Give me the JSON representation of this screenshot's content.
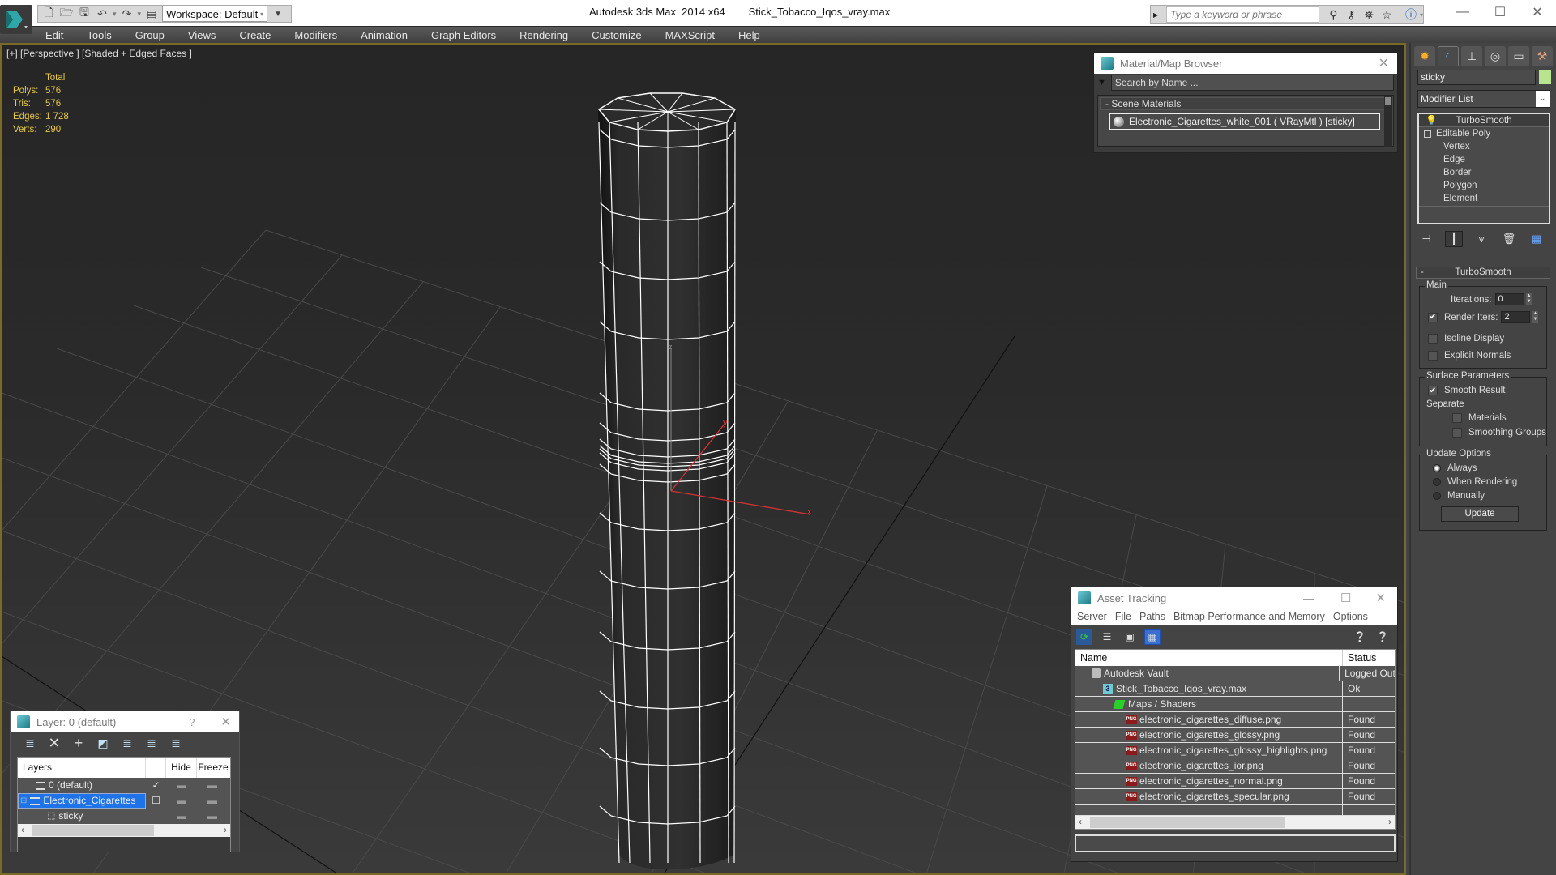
{
  "titlebar": {
    "app_title": "Autodesk 3ds Max  2014 x64",
    "file_name": "Stick_Tobacco_Iqos_vray.max",
    "workspace": "Workspace: Default",
    "search_placeholder": "Type a keyword or phrase",
    "quick_access": [
      "new-file-icon",
      "open-file-icon",
      "save-icon",
      "undo-icon",
      "redo-icon",
      "project-folder-icon"
    ],
    "info_icons": [
      "binoculars-icon",
      "key-icon",
      "satellite-icon",
      "star-icon",
      "help-icon"
    ],
    "window_buttons": {
      "minimize": "—",
      "maximize": "☐",
      "close": "✕"
    }
  },
  "menu": [
    "Edit",
    "Tools",
    "Group",
    "Views",
    "Create",
    "Modifiers",
    "Animation",
    "Graph Editors",
    "Rendering",
    "Customize",
    "MAXScript",
    "Help"
  ],
  "viewport": {
    "label": "[+] [Perspective ] [Shaded + Edged Faces ]",
    "stats": {
      "header": "Total",
      "rows": [
        {
          "key": "Polys:",
          "value": "576"
        },
        {
          "key": "Tris:",
          "value": "576"
        },
        {
          "key": "Edges:",
          "value": "1 728"
        },
        {
          "key": "Verts:",
          "value": "290"
        }
      ]
    },
    "axis_labels": {
      "x": "x",
      "y": "y",
      "z": "z"
    }
  },
  "material_browser": {
    "title": "Material/Map Browser",
    "search_placeholder": "Search by Name ...",
    "section": "- Scene Materials",
    "items": [
      "Electronic_Cigarettes_white_001  ( VRayMtl ) [sticky]"
    ]
  },
  "command_panel": {
    "tabs": [
      "create-tab",
      "modify-tab",
      "hierarchy-tab",
      "motion-tab",
      "display-tab",
      "utilities-tab"
    ],
    "object_name": "sticky",
    "object_color": "#b9e48f",
    "modifier_list": "Modifier List",
    "stack": {
      "top": "TurboSmooth",
      "base": "Editable Poly",
      "sub": [
        "Vertex",
        "Edge",
        "Border",
        "Polygon",
        "Element"
      ]
    },
    "turbosmooth": {
      "title": "TurboSmooth",
      "main_label": "Main",
      "iterations_label": "Iterations:",
      "iterations": "0",
      "render_iters_label": "Render Iters:",
      "render_iters": "2",
      "render_iters_checked": true,
      "isoline_label": "Isoline Display",
      "isoline_checked": false,
      "explicit_normals_label": "Explicit Normals",
      "explicit_normals_checked": false,
      "surface_label": "Surface Parameters",
      "smooth_result_label": "Smooth Result",
      "smooth_result_checked": true,
      "separate_label": "Separate",
      "materials_label": "Materials",
      "smoothing_groups_label": "Smoothing Groups",
      "update_label": "Update Options",
      "update_options": [
        "Always",
        "When Rendering",
        "Manually"
      ],
      "update_selected": "Always",
      "update_button": "Update"
    }
  },
  "asset_tracking": {
    "title": "Asset Tracking",
    "menu": [
      "Server",
      "File",
      "Paths",
      "Bitmap Performance and Memory",
      "Options"
    ],
    "columns": [
      "Name",
      "Status"
    ],
    "rows": [
      {
        "name": "Autodesk Vault",
        "status": "Logged Out",
        "icon": "vault-icon",
        "indent": 1
      },
      {
        "name": "Stick_Tobacco_Iqos_vray.max",
        "status": "Ok",
        "icon": "max-file-icon",
        "indent": 2
      },
      {
        "name": "Maps / Shaders",
        "status": "",
        "icon": "maps-icon",
        "indent": 3
      },
      {
        "name": "electronic_cigarettes_diffuse.png",
        "status": "Found",
        "icon": "png-icon",
        "indent": 4
      },
      {
        "name": "electronic_cigarettes_glossy.png",
        "status": "Found",
        "icon": "png-icon",
        "indent": 4
      },
      {
        "name": "electronic_cigarettes_glossy_highlights.png",
        "status": "Found",
        "icon": "png-icon",
        "indent": 4
      },
      {
        "name": "electronic_cigarettes_ior.png",
        "status": "Found",
        "icon": "png-icon",
        "indent": 4
      },
      {
        "name": "electronic_cigarettes_normal.png",
        "status": "Found",
        "icon": "png-icon",
        "indent": 4
      },
      {
        "name": "electronic_cigarettes_specular.png",
        "status": "Found",
        "icon": "png-icon",
        "indent": 4
      }
    ]
  },
  "layer_dialog": {
    "title": "Layer: 0 (default)",
    "help": "?",
    "columns": [
      "Layers",
      "",
      "Hide",
      "Freeze"
    ],
    "rows": [
      {
        "name": "0 (default)",
        "current": "✓",
        "selected": false,
        "type": "layer"
      },
      {
        "name": "Electronic_Cigarettes",
        "current": "☐",
        "selected": true,
        "type": "layer"
      },
      {
        "name": "sticky",
        "current": "",
        "selected": false,
        "type": "object"
      }
    ]
  }
}
